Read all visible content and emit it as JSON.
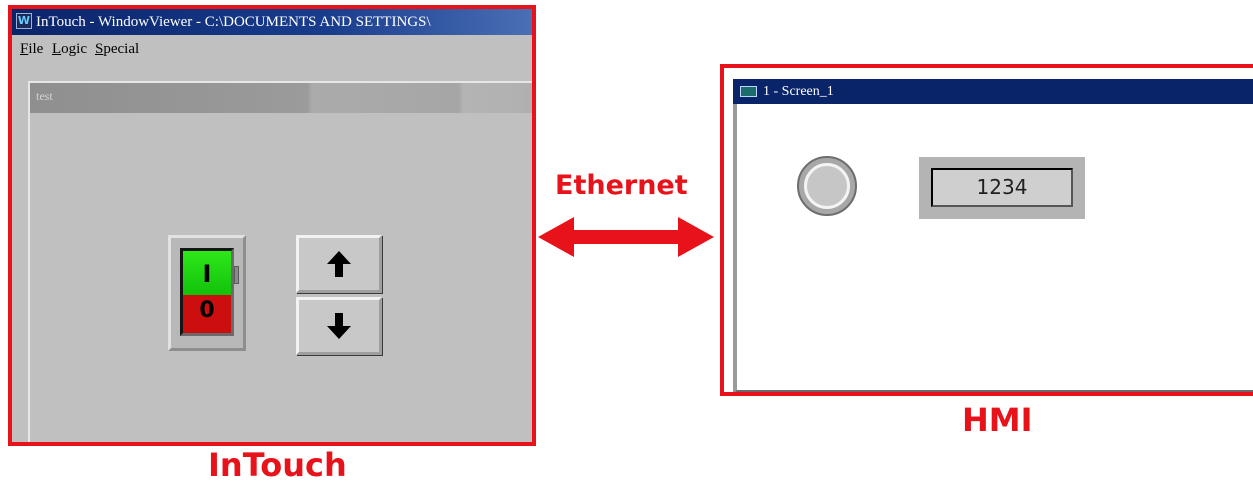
{
  "intouch": {
    "window_title": "InTouch - WindowViewer - C:\\DOCUMENTS AND SETTINGS\\",
    "menu": [
      {
        "mnemonic": "F",
        "rest": "ile"
      },
      {
        "mnemonic": "L",
        "rest": "ogic"
      },
      {
        "mnemonic": "S",
        "rest": "pecial"
      }
    ],
    "client_window_label": "test",
    "switch": {
      "on_label": "I",
      "off_label": "0",
      "state_color_on": "#18d010",
      "state_color_off": "#cc0e0e"
    },
    "buttons": {
      "up_icon": "arrow-up-icon",
      "down_icon": "arrow-down-icon"
    },
    "caption": "InTouch"
  },
  "link": {
    "label": "Ethernet",
    "icon": "double-headed-arrow-icon",
    "color": "#e8121b"
  },
  "hmi": {
    "window_title": "1 - Screen_1",
    "lamp_icon": "indicator-lamp-icon",
    "numeric_display_value": "1234",
    "caption": "HMI"
  },
  "colors": {
    "frame_highlight": "#e8121b",
    "titlebar": "#0a246a",
    "window_face": "#c0c0c0"
  }
}
